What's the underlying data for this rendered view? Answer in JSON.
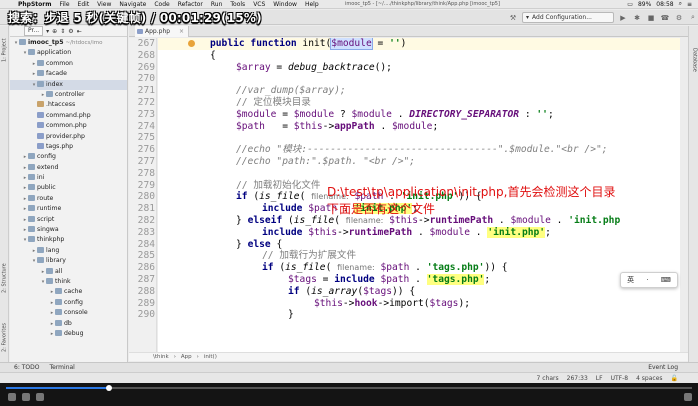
{
  "overlay": {
    "text": "搜索：步退 5 秒(关键帧) / 00:01:29(15%)"
  },
  "progress": {
    "fraction": 0.15
  },
  "menubar": {
    "app": "PhpStorm",
    "items": [
      "File",
      "Edit",
      "View",
      "Navigate",
      "Code",
      "Refactor",
      "Run",
      "Tools",
      "VCS",
      "Window",
      "Help"
    ],
    "window_title": "imooc_tp5 - [~/..../thinkphp/library/think/App.php [imooc_tp5]",
    "battery": "89%",
    "time": "08:58"
  },
  "toolbar": {
    "run_config": "Add Configuration..."
  },
  "project": {
    "selector": "Pr...",
    "root": "imooc_tp5",
    "root_path": "~/htdocs/imo",
    "tree": [
      {
        "label": "application",
        "type": "folder",
        "depth": 1,
        "open": true
      },
      {
        "label": "common",
        "type": "folder",
        "depth": 2,
        "open": false
      },
      {
        "label": "facade",
        "type": "folder",
        "depth": 2,
        "open": false
      },
      {
        "label": "index",
        "type": "folder",
        "depth": 2,
        "open": true,
        "selected": true
      },
      {
        "label": "controller",
        "type": "folder",
        "depth": 3,
        "open": false
      },
      {
        "label": ".htaccess",
        "type": "dot",
        "depth": 2
      },
      {
        "label": "command.php",
        "type": "php",
        "depth": 2
      },
      {
        "label": "common.php",
        "type": "php",
        "depth": 2
      },
      {
        "label": "provider.php",
        "type": "php",
        "depth": 2
      },
      {
        "label": "tags.php",
        "type": "php",
        "depth": 2
      },
      {
        "label": "config",
        "type": "folder",
        "depth": 1,
        "open": false
      },
      {
        "label": "extend",
        "type": "folder",
        "depth": 1,
        "open": false
      },
      {
        "label": "ini",
        "type": "folder",
        "depth": 1,
        "open": false
      },
      {
        "label": "public",
        "type": "folder",
        "depth": 1,
        "open": false
      },
      {
        "label": "route",
        "type": "folder",
        "depth": 1,
        "open": false
      },
      {
        "label": "runtime",
        "type": "folder",
        "depth": 1,
        "open": false
      },
      {
        "label": "script",
        "type": "folder",
        "depth": 1,
        "open": false
      },
      {
        "label": "singwa",
        "type": "folder",
        "depth": 1,
        "open": false
      },
      {
        "label": "thinkphp",
        "type": "folder",
        "depth": 1,
        "open": true
      },
      {
        "label": "lang",
        "type": "folder",
        "depth": 2,
        "open": false
      },
      {
        "label": "library",
        "type": "folder",
        "depth": 2,
        "open": true
      },
      {
        "label": "all",
        "type": "folder",
        "depth": 3,
        "open": false
      },
      {
        "label": "think",
        "type": "folder",
        "depth": 3,
        "open": true
      },
      {
        "label": "cache",
        "type": "folder",
        "depth": 4,
        "open": false
      },
      {
        "label": "config",
        "type": "folder",
        "depth": 4,
        "open": false
      },
      {
        "label": "console",
        "type": "folder",
        "depth": 4,
        "open": false
      },
      {
        "label": "db",
        "type": "folder",
        "depth": 4,
        "open": false
      },
      {
        "label": "debug",
        "type": "folder",
        "depth": 4,
        "open": false
      }
    ]
  },
  "side_tabs": {
    "left": [
      "1: Project",
      "2: Structure",
      "2: Favorites"
    ],
    "right": [
      "Database"
    ]
  },
  "editor": {
    "tab": "App.php",
    "lines": [
      267,
      268,
      269,
      270,
      271,
      272,
      273,
      274,
      275,
      276,
      277,
      278,
      279,
      280,
      281,
      282,
      283,
      284,
      285,
      286,
      287,
      288,
      289,
      290
    ],
    "annotation": [
      "D:\\test\\tp\\application\\init.php,首先会检测这个目录",
      "下面是否有这个文件"
    ]
  },
  "breadcrumb": [
    "\\think",
    "App",
    "init()"
  ],
  "ime": {
    "items": [
      "英",
      "·",
      "⌨"
    ]
  },
  "toolwindows": {
    "todo": "6: TODO",
    "terminal": "Terminal",
    "event_log": "Event Log"
  },
  "status": {
    "chars": "7 chars",
    "position": "267:33",
    "line_sep": "LF",
    "encoding": "UTF-8",
    "indent": "4 spaces"
  }
}
